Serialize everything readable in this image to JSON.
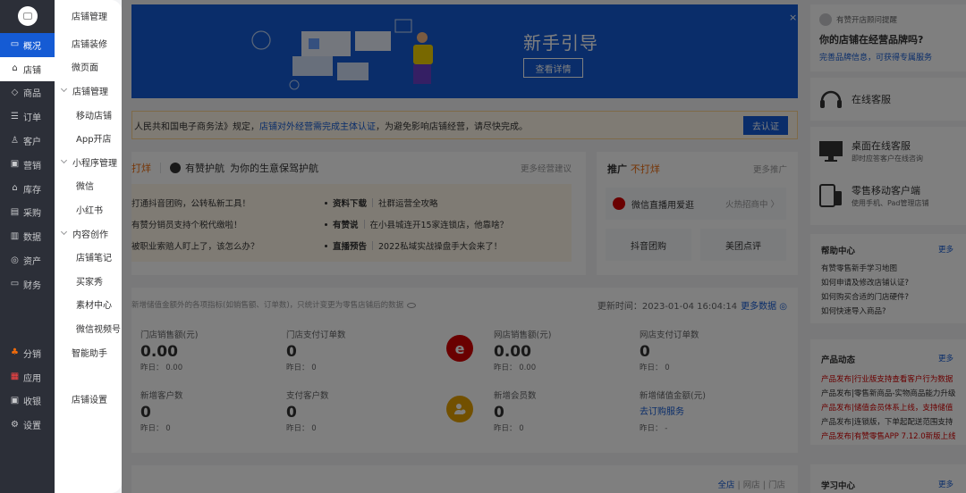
{
  "nav1": {
    "items": [
      {
        "label": "概况",
        "icon": "speech-bubble-icon",
        "glyph": "▭"
      },
      {
        "label": "店铺",
        "icon": "store-icon",
        "glyph": "⌂"
      },
      {
        "label": "商品",
        "icon": "tag-icon",
        "glyph": "◇"
      },
      {
        "label": "订单",
        "icon": "order-icon",
        "glyph": "☰"
      },
      {
        "label": "客户",
        "icon": "customer-icon",
        "glyph": "♙"
      },
      {
        "label": "营销",
        "icon": "gift-icon",
        "glyph": "▣"
      },
      {
        "label": "库存",
        "icon": "warehouse-icon",
        "glyph": "⌂"
      },
      {
        "label": "采购",
        "icon": "purchase-icon",
        "glyph": "▤"
      },
      {
        "label": "数据",
        "icon": "bar-chart-icon",
        "glyph": "▥"
      },
      {
        "label": "资产",
        "icon": "coin-icon",
        "glyph": "◎"
      },
      {
        "label": "财务",
        "icon": "finance-icon",
        "glyph": "▭"
      }
    ],
    "items2": [
      {
        "label": "分销",
        "icon": "distribution-icon",
        "glyph": "♣"
      },
      {
        "label": "应用",
        "icon": "apps-icon",
        "glyph": "▦"
      },
      {
        "label": "收银",
        "icon": "cashier-icon",
        "glyph": "▣"
      },
      {
        "label": "设置",
        "icon": "gear-icon",
        "glyph": "⚙"
      }
    ],
    "active": 0,
    "hover": 1
  },
  "nav2": {
    "header": "店铺管理",
    "items": [
      {
        "label": "店铺装修",
        "type": "item"
      },
      {
        "label": "微页面",
        "type": "item"
      },
      {
        "label": "店铺管理",
        "type": "grp"
      },
      {
        "label": "移动店铺",
        "type": "sub"
      },
      {
        "label": "App开店",
        "type": "sub"
      },
      {
        "label": "小程序管理",
        "type": "grp"
      },
      {
        "label": "微信",
        "type": "sub"
      },
      {
        "label": "小红书",
        "type": "sub"
      },
      {
        "label": "内容创作",
        "type": "grp"
      },
      {
        "label": "店铺笔记",
        "type": "sub"
      },
      {
        "label": "买家秀",
        "type": "sub"
      },
      {
        "label": "素材中心",
        "type": "sub"
      },
      {
        "label": "微信视频号",
        "type": "sub"
      },
      {
        "label": "智能助手",
        "type": "item"
      }
    ],
    "footer": "店铺设置"
  },
  "banner": {
    "title": "新手引导",
    "button": "查看详情",
    "close": "×"
  },
  "notice": {
    "text1": "人民共和国电子商务法》规定，",
    "text2": "店铺对外经营需完成主体认证",
    "text3": "，为避免影响店铺经营，请尽快完成。",
    "button": "去认证"
  },
  "news": {
    "head_orange": "打烊",
    "brand": "有赞护航",
    "slogan": "为你的生意保驾护航",
    "more": "更多经营建议",
    "left": [
      "打通抖音团购，公转私新工具！",
      "有赞分销员支持个税代缴啦！",
      "被职业索赔人盯上了，该怎么办？"
    ],
    "right": [
      {
        "tag": "资料下载",
        "text": "社群运营全攻略"
      },
      {
        "tag": "有赞说",
        "text": "在小县城连开15家连锁店，他靠啥？"
      },
      {
        "tag": "直播预告",
        "text": "2022私域实战操盘手大会来了！"
      }
    ]
  },
  "promo": {
    "title": "推广",
    "title_orange": "不打烊",
    "more": "更多推广",
    "live": "微信直播用爱逛",
    "live_right": "火热招商中 〉",
    "btn1": "抖音团购",
    "btn2": "美团点评"
  },
  "stats": {
    "note": "新增储值金额外的各项指标(如销售额、订单数)，只统计变更为零售店铺后的数据",
    "updated_label": "更新时间：",
    "updated": "2023-01-04 16:04:14",
    "more": "更多数据 ◎",
    "cells": [
      {
        "label": "门店销售额(元)",
        "value": "0.00",
        "yest": "昨日： 0.00"
      },
      {
        "label": "门店支付订单数",
        "value": "0",
        "yest": "昨日： 0"
      },
      {
        "label": "网店销售额(元)",
        "value": "0.00",
        "yest": "昨日： 0.00"
      },
      {
        "label": "网店支付订单数",
        "value": "0",
        "yest": "昨日： 0"
      },
      {
        "label": "新增客户数",
        "value": "0",
        "yest": "昨日： 0"
      },
      {
        "label": "支付客户数",
        "value": "0",
        "yest": "昨日： 0"
      },
      {
        "label": "新增会员数",
        "value": "0",
        "yest": "昨日： 0"
      },
      {
        "label": "新增储值金额(元)",
        "value": "去订购服务",
        "yest": "昨日： -"
      }
    ],
    "badge1": "e",
    "badge1_color": "#d40000",
    "badge2_color": "#e5a100"
  },
  "bottom": {
    "tab1": "全店",
    "tab2": "网店",
    "tab3": "门店"
  },
  "right": {
    "tip": "有赞开店顾问提醒",
    "question": "你的店铺在经营品牌吗?",
    "sub": "完善品牌信息，可获得专属服务",
    "online": "在线客服",
    "desktop": "桌面在线客服",
    "desktop_sub": "即时应答客户在线咨询",
    "mobile": "零售移动客户端",
    "mobile_sub": "使用手机、Pad管理店铺",
    "help_title": "帮助中心",
    "more": "更多",
    "help": [
      "有赞零售新手学习地图",
      "如何申请及修改店铺认证?",
      "如何购买合适的门店硬件?",
      "如何快速导入商品?"
    ],
    "product_title": "产品动态",
    "product": [
      {
        "text": "产品发布|行业版支持查看客户行为数据",
        "red": true
      },
      {
        "text": "产品发布|零售新商品-实物商品能力升级",
        "red": false
      },
      {
        "text": "产品发布|储值会员体系上线，支持储值",
        "red": true
      },
      {
        "text": "产品发布|连锁版，下单起配送范围支持",
        "red": false
      },
      {
        "text": "产品发布|有赞零售APP 7.12.0新版上线",
        "red": true
      }
    ],
    "learn_title": "学习中心"
  }
}
